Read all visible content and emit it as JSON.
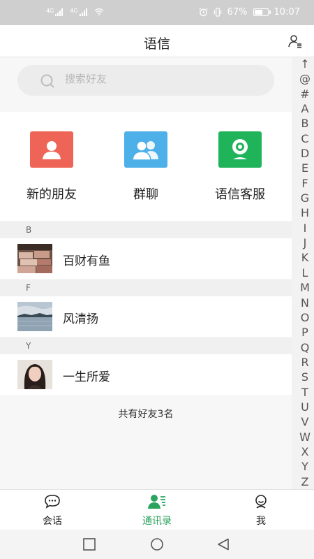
{
  "status_bar": {
    "sim1_label": "4G",
    "sim2_label": "4G",
    "battery_percent": "67%",
    "battery_level": 0.67,
    "time": "10:07"
  },
  "header": {
    "title": "语信",
    "contact_manage_icon": "person-list-icon"
  },
  "search": {
    "placeholder": "搜索好友",
    "value": ""
  },
  "quick_actions": [
    {
      "label": "新的朋友",
      "icon": "person-icon",
      "color": "#ee6557"
    },
    {
      "label": "群聊",
      "icon": "group-icon",
      "color": "#4eb0e8"
    },
    {
      "label": "语信客服",
      "icon": "webcam-icon",
      "color": "#1fb45a"
    }
  ],
  "contacts": [
    {
      "letter": "B",
      "name": "百财有鱼",
      "avatar": "money-photo"
    },
    {
      "letter": "F",
      "name": "风清扬",
      "avatar": "lake-landscape-photo"
    },
    {
      "letter": "Y",
      "name": "一生所爱",
      "avatar": "portrait-photo"
    }
  ],
  "total_friends": "共有好友3名",
  "index_letters": [
    "↑",
    "@",
    "#",
    "A",
    "B",
    "C",
    "D",
    "E",
    "F",
    "G",
    "H",
    "I",
    "J",
    "K",
    "L",
    "M",
    "N",
    "O",
    "P",
    "Q",
    "R",
    "S",
    "T",
    "U",
    "V",
    "W",
    "X",
    "Y",
    "Z"
  ],
  "tabs": [
    {
      "label": "会话",
      "icon": "chat-bubble-icon",
      "active": false
    },
    {
      "label": "通讯录",
      "icon": "contacts-icon",
      "active": true
    },
    {
      "label": "我",
      "icon": "me-icon",
      "active": false
    }
  ],
  "colors": {
    "accent_green": "#2ba35e",
    "new_friend_red": "#ee6557",
    "group_blue": "#4eb0e8",
    "service_green": "#1fb45a"
  }
}
